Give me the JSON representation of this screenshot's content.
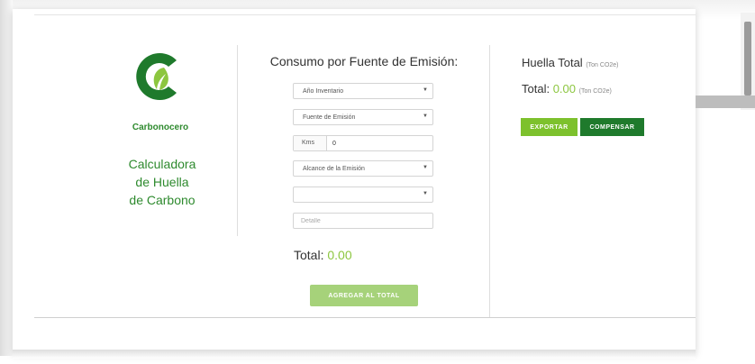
{
  "brand": {
    "name": "Carbonocero",
    "calculator_title": [
      "Calculadora",
      "de Huella",
      "de Carbono"
    ],
    "logo_icon": "carbonocero-leaf-logo-icon",
    "colors": {
      "green_dark": "#1f7a2c",
      "green_light": "#8cc63f"
    }
  },
  "form": {
    "title": "Consumo por Fuente de Emisión:",
    "selects": [
      {
        "value": "Año Inventario"
      },
      {
        "value": "Fuente de Emisión"
      },
      {
        "value": "Alcance de la Emisión"
      },
      {
        "value": ""
      }
    ],
    "kms": {
      "label": "Kms",
      "value": "0"
    },
    "detail": {
      "placeholder": "Detalle"
    },
    "total": {
      "label": "Total:",
      "value": "0.00"
    },
    "add_button": "AGREGAR AL TOTAL"
  },
  "summary": {
    "title": "Huella Total",
    "title_unit": "(Ton CO2e)",
    "total_label": "Total:",
    "total_value": "0.00",
    "total_unit": "(Ton CO2e)",
    "export_button": "EXPORTAR",
    "compensate_button": "COMPENSAR",
    "colors": {
      "export": "#7dc12d",
      "compensate": "#1f7a2c"
    }
  }
}
